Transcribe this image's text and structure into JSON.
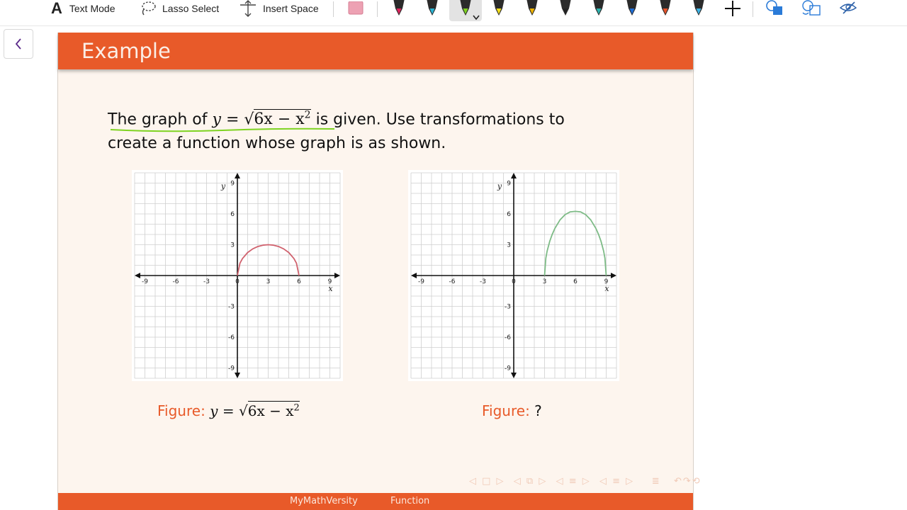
{
  "toolbar": {
    "text_mode_label": "Text Mode",
    "lasso_select_label": "Lasso Select",
    "insert_space_label": "Insert Space",
    "pen_colors": [
      "#e0245e",
      "#29b6d6",
      "#7ed321",
      "#f5e11a",
      "#f0b400",
      "#222222",
      "#2bb5b0",
      "#1e6fd9",
      "#e8532a",
      "#3cb4e6"
    ],
    "selected_pen_index": 2
  },
  "slide": {
    "title": "Example",
    "problem_line1_a": "The graph of",
    "problem_y": "y",
    "problem_eq": "=",
    "problem_radicand": "6x − x",
    "problem_exp": "2",
    "problem_line1_b": "is given. Use transformations to",
    "problem_line2": "create a function whose graph is as shown.",
    "caption_left_label": "Figure:",
    "caption_left_y": "y",
    "caption_left_eq": "=",
    "caption_left_radicand": "6x − x",
    "caption_left_exp": "2",
    "caption_right_label": "Figure:",
    "caption_right_value": "?",
    "footer_left": "MyMathVersity",
    "footer_right": "Function",
    "accent_color": "#e85a29"
  },
  "graphs": {
    "tick_labels_x": [
      "-9",
      "-6",
      "-3",
      "0",
      "3",
      "6",
      "9"
    ],
    "tick_labels_y": [
      "9",
      "6",
      "3",
      "-3",
      "-6",
      "-9"
    ],
    "axis_x_label": "x",
    "axis_y_label": "y"
  },
  "chart_data": [
    {
      "type": "line",
      "xlim": [
        -10,
        10
      ],
      "ylim": [
        -10,
        10
      ],
      "grid": true,
      "xlabel": "x",
      "ylabel": "y",
      "series": [
        {
          "color": "#d0626e",
          "x": [
            0,
            0.25,
            0.5,
            1,
            1.5,
            2,
            2.5,
            3,
            3.5,
            4,
            4.5,
            5,
            5.5,
            5.75,
            6
          ],
          "y": [
            0,
            1.2,
            1.66,
            2.24,
            2.6,
            2.83,
            2.96,
            3,
            2.96,
            2.83,
            2.6,
            2.24,
            1.66,
            1.2,
            0
          ]
        }
      ]
    },
    {
      "type": "line",
      "xlim": [
        -10,
        10
      ],
      "ylim": [
        -10,
        10
      ],
      "grid": true,
      "xlabel": "x",
      "ylabel": "y",
      "series": [
        {
          "color": "#7dbb86",
          "x": [
            3,
            3.125,
            3.25,
            3.5,
            3.75,
            4,
            4.5,
            5,
            5.5,
            6,
            6.5,
            7,
            7.5,
            8,
            8.25,
            8.5,
            8.75,
            8.875,
            9
          ],
          "y": [
            0,
            1.69,
            2.38,
            3.32,
            4.02,
            4.58,
            5.41,
            5.93,
            6.2,
            6.25,
            6.2,
            5.93,
            5.41,
            4.58,
            4.02,
            3.32,
            2.38,
            1.69,
            0
          ]
        }
      ]
    }
  ]
}
